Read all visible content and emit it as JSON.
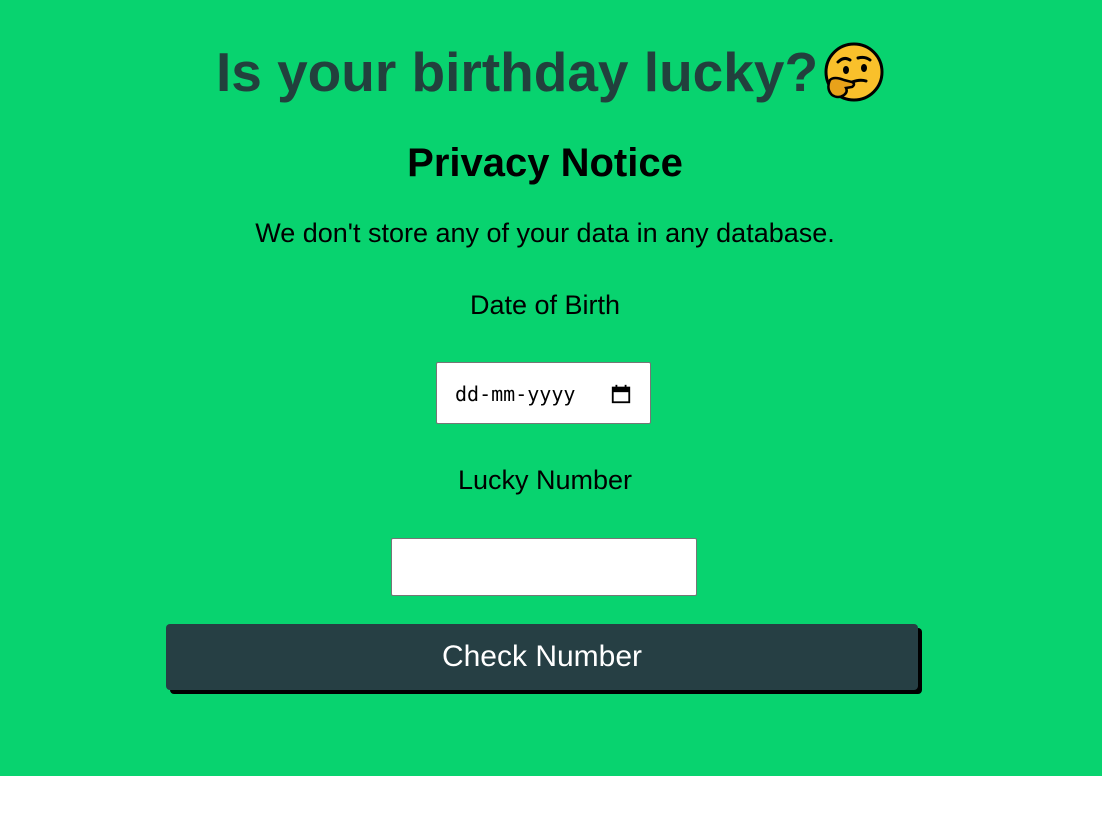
{
  "header": {
    "title": "Is your birthday lucky?",
    "emoji_icon": "thinking-face-icon"
  },
  "privacy": {
    "heading": "Privacy Notice",
    "text": "We don't store any of your data in any database."
  },
  "form": {
    "dob_label": "Date of Birth",
    "dob_placeholder": "dd-mm-yyyy",
    "dob_icon": "calendar-icon",
    "lucky_label": "Lucky Number",
    "lucky_value": "",
    "submit_label": "Check Number"
  },
  "colors": {
    "background": "#08d36f",
    "title": "#22403d",
    "button": "#263f44"
  }
}
